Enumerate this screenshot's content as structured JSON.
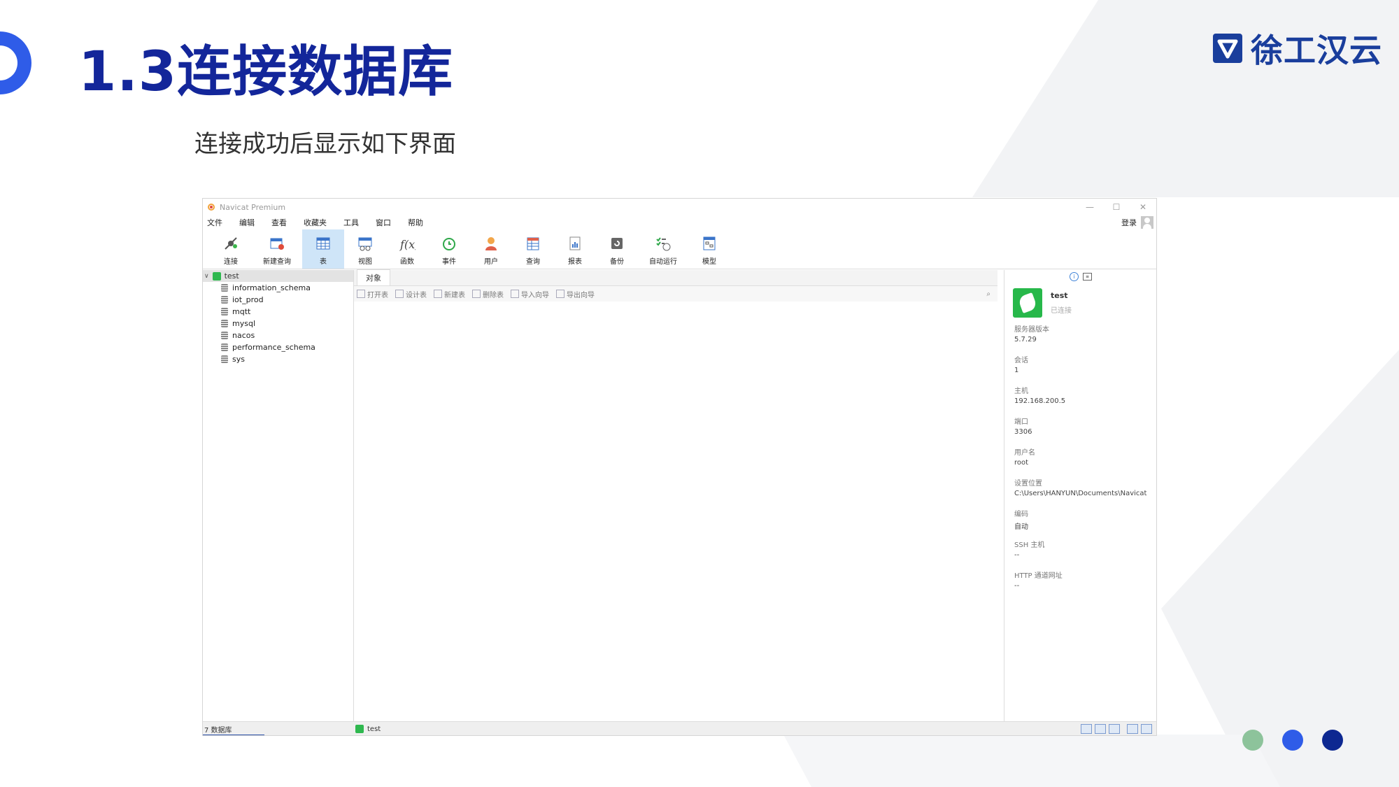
{
  "slide": {
    "title": "1.3连接数据库",
    "subtitle": "连接成功后显示如下界面",
    "brand": "徐工汉云",
    "colors": {
      "title": "#13269a",
      "accent_blue": "#2f5ce8",
      "dark_blue": "#0d2891",
      "green_dot": "#8dc39b"
    }
  },
  "app": {
    "window_title": "Navicat Premium",
    "window_controls": [
      "—",
      "☐",
      "✕"
    ],
    "menu": [
      "文件",
      "编辑",
      "查看",
      "收藏夹",
      "工具",
      "窗口",
      "帮助"
    ],
    "login_label": "登录",
    "toolbar": [
      {
        "label": "连接",
        "icon": "connect-icon"
      },
      {
        "label": "新建查询",
        "icon": "new-query-icon"
      },
      {
        "label": "表",
        "icon": "table-icon",
        "active": true
      },
      {
        "label": "视图",
        "icon": "view-icon"
      },
      {
        "label": "函数",
        "icon": "function-icon"
      },
      {
        "label": "事件",
        "icon": "event-clock-icon"
      },
      {
        "label": "用户",
        "icon": "user-icon"
      },
      {
        "label": "查询",
        "icon": "query-icon"
      },
      {
        "label": "报表",
        "icon": "report-icon"
      },
      {
        "label": "备份",
        "icon": "backup-icon"
      },
      {
        "label": "自动运行",
        "icon": "automation-icon"
      },
      {
        "label": "模型",
        "icon": "model-icon"
      }
    ],
    "tree": {
      "connection": "test",
      "databases": [
        "information_schema",
        "iot_prod",
        "mqtt",
        "mysql",
        "nacos",
        "performance_schema",
        "sys"
      ]
    },
    "objects": {
      "tab_label": "对象",
      "actions": [
        "打开表",
        "设计表",
        "新建表",
        "删除表",
        "导入向导",
        "导出向导"
      ]
    },
    "info_panel": {
      "name": "test",
      "status": "已连接",
      "properties": [
        {
          "key": "服务器版本",
          "value": "5.7.29"
        },
        {
          "key": "会话",
          "value": "1"
        },
        {
          "key": "主机",
          "value": "192.168.200.5"
        },
        {
          "key": "端口",
          "value": "3306"
        },
        {
          "key": "用户名",
          "value": "root"
        },
        {
          "key": "设置位置",
          "value": "C:\\Users\\HANYUN\\Documents\\Navicat"
        },
        {
          "key": "编码",
          "value": "自动"
        },
        {
          "key": "SSH 主机",
          "value": "--"
        },
        {
          "key": "HTTP 通道网址",
          "value": "--"
        }
      ]
    },
    "statusbar": {
      "db_count": "7 数据库",
      "connection": "test"
    }
  }
}
